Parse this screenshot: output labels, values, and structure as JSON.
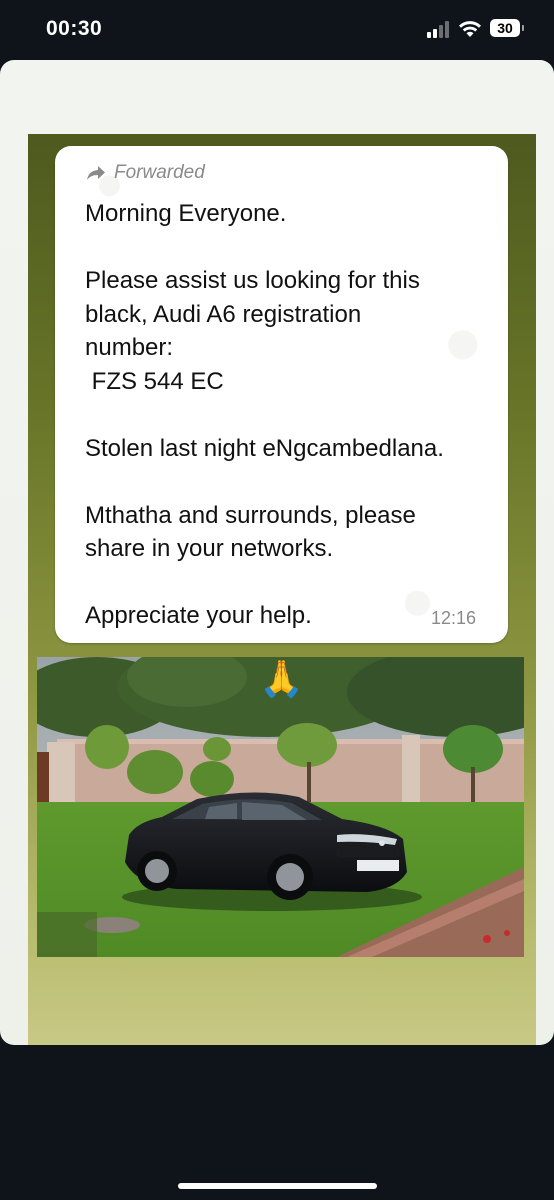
{
  "status_bar": {
    "time": "00:30",
    "battery": "30",
    "icons": [
      "signal-icon",
      "wifi-icon",
      "battery-icon"
    ]
  },
  "message": {
    "forwarded_label": "Forwarded",
    "lines": [
      "Morning Everyone.",
      "",
      "Please assist us looking for this",
      "black, Audi A6 registration",
      "number:",
      " FZS 544 EC",
      "",
      "Stolen last night eNgcambedlana.",
      "",
      "Mthatha and surrounds, please",
      "share in your networks.",
      "",
      "Appreciate your help."
    ],
    "time": "12:16"
  },
  "photo": {
    "emoji": "🙏",
    "plate": "FZS 544 EC",
    "description_icon": "car-photo"
  },
  "colors": {
    "panel_top": "#4e5a1e",
    "panel_bottom": "#c8c985",
    "bubble": "#ffffff",
    "meta_text": "#8a8a8a"
  }
}
